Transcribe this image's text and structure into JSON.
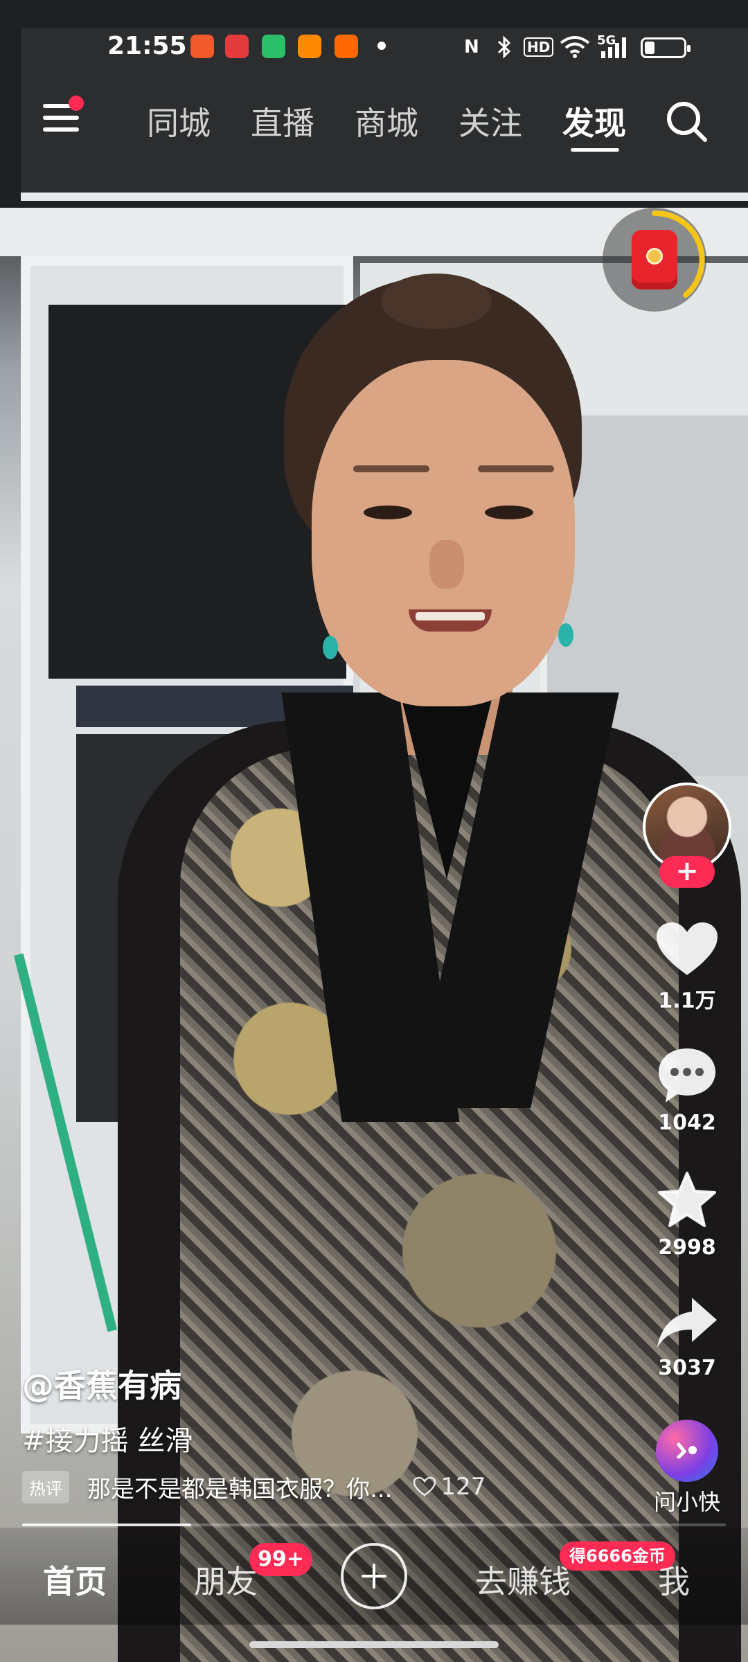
{
  "status_bar": {
    "time": "21:55",
    "nfc_label": "N",
    "hd_label": "HD",
    "network_label": "5G",
    "battery_percent": 25,
    "app_icons": [
      {
        "name": "app-icon-1",
        "color": "#f25a2c"
      },
      {
        "name": "app-icon-2",
        "color": "#e33b3b"
      },
      {
        "name": "app-icon-3",
        "color": "#2bbf6a"
      },
      {
        "name": "app-icon-4",
        "color": "#ff8a00"
      },
      {
        "name": "app-icon-5",
        "color": "#ff6a00"
      }
    ]
  },
  "top_nav": {
    "tabs": [
      {
        "label": "同城",
        "active": false
      },
      {
        "label": "直播",
        "active": false
      },
      {
        "label": "商城",
        "active": false
      },
      {
        "label": "关注",
        "active": false
      },
      {
        "label": "发现",
        "active": true
      }
    ]
  },
  "video": {
    "author": "@香蕉有病",
    "caption": "#接力摇 丝滑",
    "hot_comment": {
      "tag": "热评",
      "text": "那是不是都是韩国衣服？你...",
      "likes": "127"
    },
    "progress_fraction": 0.24
  },
  "actions": {
    "follow_label": "+",
    "likes": "1.1万",
    "comments": "1042",
    "favorites": "2998",
    "shares": "3037",
    "ai_label": "问小快"
  },
  "bottom_bar": {
    "tabs": [
      {
        "label": "首页"
      },
      {
        "label": "朋友",
        "badge": "99+"
      },
      {
        "label": "去赚钱",
        "badge": "得6666金币"
      },
      {
        "label": "我"
      }
    ]
  },
  "colors": {
    "accent": "#fe2c55",
    "red_packet": "#e8252c",
    "timer_ring": "#f5c518"
  }
}
